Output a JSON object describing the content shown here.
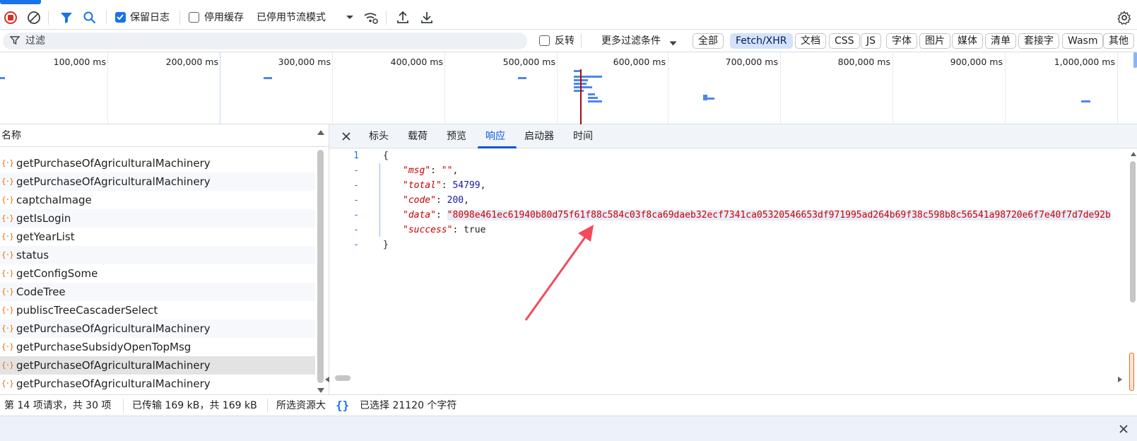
{
  "toolbar": {
    "preserve_log_label": "保留日志",
    "disable_cache_label": "停用缓存",
    "throttling_value": "已停用节流模式"
  },
  "filterbar": {
    "filter_placeholder": "过滤",
    "invert_label": "反转",
    "more_filters_label": "更多过滤条件",
    "chips": [
      "全部",
      "Fetch/XHR",
      "文档",
      "CSS",
      "JS",
      "字体",
      "图片",
      "媒体",
      "清单",
      "套接字",
      "Wasm",
      "其他"
    ],
    "selected_chip": "Fetch/XHR"
  },
  "timeline": {
    "ticks": [
      "100,000 ms",
      "200,000 ms",
      "300,000 ms",
      "400,000 ms",
      "500,000 ms",
      "600,000 ms",
      "700,000 ms",
      "800,000 ms",
      "900,000 ms",
      "1,000,000 ms"
    ]
  },
  "requests": {
    "header": "名称",
    "items": [
      "getPurchaseOfAgriculturalMachinery",
      "getPurchaseOfAgriculturalMachinery",
      "captchaImage",
      "getIsLogin",
      "getYearList",
      "status",
      "getConfigSome",
      "CodeTree",
      "publiscTreeCascaderSelect",
      "getPurchaseOfAgriculturalMachinery",
      "getPurchaseSubsidyOpenTopMsg",
      "getPurchaseOfAgriculturalMachinery",
      "getPurchaseOfAgriculturalMachinery"
    ],
    "selected_index": 11
  },
  "detail_tabs": {
    "items": [
      "标头",
      "载荷",
      "预览",
      "响应",
      "启动器",
      "时间"
    ],
    "active": "响应"
  },
  "response": {
    "line1_number": "1",
    "fold_marker": "-",
    "open_brace": "{",
    "close_brace": "}",
    "msg_key": "\"msg\"",
    "msg_value": "\"\"",
    "total_key": "\"total\"",
    "total_value": "54799",
    "code_key": "\"code\"",
    "code_value": "200",
    "data_key": "\"data\"",
    "data_value": "\"8098e461ec61940b80d75f61f88c584c03f8ca69daeb32ecf7341ca05320546653df971995ad264b69f38c598b8c56541a98720e6f7e40f7d7de92b",
    "success_key": "\"success\"",
    "success_value": "true"
  },
  "status": {
    "requests": "第 14 项请求，共 30 项",
    "transferred": "已传输 169 kB，共 169 kB",
    "resources": "所选资源大",
    "selection": "已选择 21120 个字符"
  },
  "colors": {
    "accent": "#1a73e8",
    "selected_chip_bg": "#d3e3fd",
    "xhr_icon": "#e8710a",
    "json_key": "#c80000",
    "json_number": "#1a1aa6",
    "arrow": "#f24b5b"
  }
}
